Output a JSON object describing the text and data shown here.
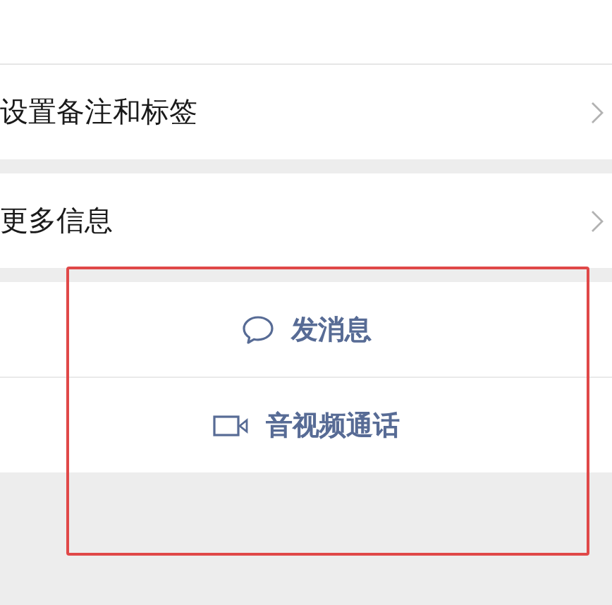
{
  "menu_rows": [
    {
      "label": "设置备注和标签"
    },
    {
      "label": "更多信息"
    }
  ],
  "actions": [
    {
      "kind": "message",
      "label": "发消息"
    },
    {
      "kind": "video",
      "label": "音视频通话"
    }
  ],
  "highlight": {
    "color": "#e04848"
  }
}
